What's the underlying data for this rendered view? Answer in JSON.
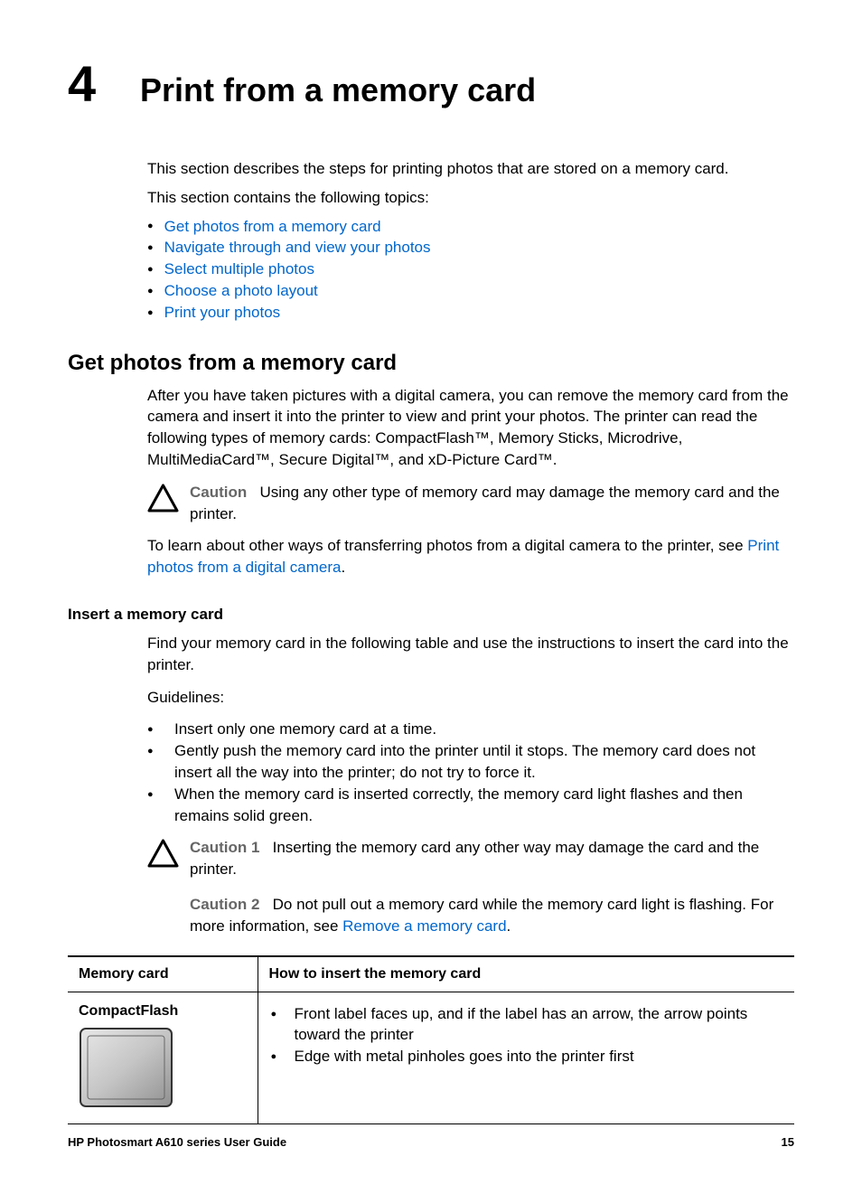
{
  "chapter": {
    "number": "4",
    "title": "Print from a memory card"
  },
  "intro": {
    "line1": "This section describes the steps for printing photos that are stored on a memory card.",
    "line2": "This section contains the following topics:"
  },
  "toc": {
    "items": [
      "Get photos from a memory card",
      "Navigate through and view your photos",
      "Select multiple photos",
      "Choose a photo layout",
      "Print your photos"
    ]
  },
  "section1": {
    "heading": "Get photos from a memory card",
    "body": "After you have taken pictures with a digital camera, you can remove the memory card from the camera and insert it into the printer to view and print your photos. The printer can read the following types of memory cards: CompactFlash™, Memory Sticks, Microdrive, MultiMediaCard™, Secure Digital™, and xD-Picture Card™.",
    "caution_label": "Caution",
    "caution_text": "Using any other type of memory card may damage the memory card and the printer.",
    "transfer_text_pre": "To learn about other ways of transferring photos from a digital camera to the printer, see ",
    "transfer_link": "Print photos from a digital camera",
    "transfer_text_post": "."
  },
  "subsection": {
    "heading": "Insert a memory card",
    "intro": "Find your memory card in the following table and use the instructions to insert the card into the printer.",
    "guidelines_label": "Guidelines:",
    "guidelines": [
      "Insert only one memory card at a time.",
      "Gently push the memory card into the printer until it stops. The memory card does not insert all the way into the printer; do not try to force it.",
      "When the memory card is inserted correctly, the memory card light flashes and then remains solid green."
    ],
    "caution1_label": "Caution 1",
    "caution1_text": "Inserting the memory card any other way may damage the card and the printer.",
    "caution2_label": "Caution 2",
    "caution2_text_pre": "Do not pull out a memory card while the memory card light is flashing. For more information, see ",
    "caution2_link": "Remove a memory card",
    "caution2_text_post": "."
  },
  "table": {
    "col1": "Memory card",
    "col2": "How to insert the memory card",
    "row1": {
      "name": "CompactFlash",
      "instructions": [
        "Front label faces up, and if the label has an arrow, the arrow points toward the printer",
        "Edge with metal pinholes goes into the printer first"
      ]
    }
  },
  "footer": {
    "guide": "HP Photosmart A610 series User Guide",
    "page": "15"
  }
}
